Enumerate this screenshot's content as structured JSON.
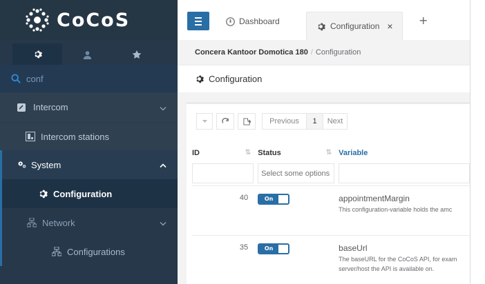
{
  "app": {
    "logo_text": "CoCoS"
  },
  "sidebar": {
    "tabs": [
      {
        "icon": "gear-icon",
        "active": true
      },
      {
        "icon": "user-icon",
        "active": false
      },
      {
        "icon": "star-icon",
        "active": false
      }
    ],
    "search": {
      "value": "conf"
    },
    "items": [
      {
        "label": "Intercom",
        "icon": "intercom-icon",
        "chevron": "chevron-down-icon"
      },
      {
        "label": "Intercom stations",
        "icon": "station-icon"
      },
      {
        "label": "System",
        "icon": "gears-icon",
        "chevron": "chevron-up-icon"
      },
      {
        "label": "Configuration",
        "icon": "gear-icon"
      },
      {
        "label": "Network",
        "icon": "network-icon",
        "chevron": "chevron-down-icon"
      },
      {
        "label": "Configurations",
        "icon": "network-icon"
      }
    ]
  },
  "topbar": {
    "tabs": [
      {
        "label": "Dashboard",
        "icon": "dashboard-icon"
      },
      {
        "label": "Configuration",
        "icon": "gear-icon",
        "close": "×"
      }
    ],
    "add_label": "+"
  },
  "breadcrumb": {
    "root": "Concera Kantoor Domotica 180",
    "separator": "/",
    "current": "Configuration"
  },
  "page": {
    "title": "Configuration"
  },
  "toolbar": {
    "previous": "Previous",
    "page": "1",
    "next": "Next"
  },
  "table": {
    "columns": [
      "ID",
      "Status",
      "Variable"
    ],
    "filter_placeholder": "Select some options",
    "rows": [
      {
        "id": "40",
        "status": "On",
        "variable": "appointmentMargin",
        "description": "This configuration-variable holds the amc"
      },
      {
        "id": "35",
        "status": "On",
        "variable": "baseUrl",
        "description": "The baseURL for the CoCoS API, for exam",
        "description2": "server/host the API is available on."
      }
    ]
  },
  "colors": {
    "sidebar_bg": "#2f4050",
    "accent": "#2a6ea6",
    "active_item_bg": "#1e3246"
  }
}
